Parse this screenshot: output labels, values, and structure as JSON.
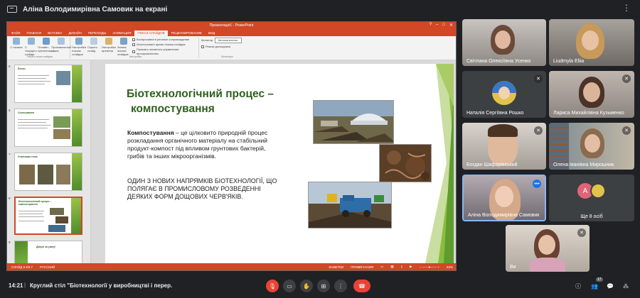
{
  "meet": {
    "presenting_label": "Аліна Володимирівна Самовик на екрані",
    "time": "14:21",
    "separator": "|",
    "meeting_title": "Круглий стіл \"Біотехнології у виробництві і перер...",
    "people_count": "17",
    "participants": [
      {
        "name": "Світлана Олексіївна Усенко"
      },
      {
        "name": "Liudmyla Eliia"
      },
      {
        "name": "Наталія Сергіївна Рошко"
      },
      {
        "name": "Лариса Михайлівна Кузьменко"
      },
      {
        "name": "Богдан Шафарівський"
      },
      {
        "name": "Олена Іванівна Мирошник"
      },
      {
        "name": "Аліна Володимирівна Самовик"
      },
      {
        "name": "Ще 8 осіб",
        "initial": "A"
      },
      {
        "name": "Ви"
      }
    ],
    "colors": {
      "bg": "#202124",
      "tile": "#3c4043",
      "red": "#ea4335",
      "accent": "#8ab4f8"
    }
  },
  "ppt": {
    "window_title": "Презентація1 - PowerPoint",
    "tabs": [
      "ФАЙЛ",
      "ГЛАВНАЯ",
      "ВСТАВКА",
      "ДИЗАЙН",
      "ПЕРЕХОДЫ",
      "АНИМАЦИЯ",
      "ПОКАЗ СЛАЙДОВ",
      "РЕЦЕНЗИРОВАНИЕ",
      "ВИД"
    ],
    "active_tab": "ПОКАЗ СЛАЙДОВ",
    "ribbon_buttons": [
      "С начала",
      "С текущего слайда",
      "Онлайн-презентация",
      "Произвольный показ",
      "Настройка показа слайдов",
      "Скрыть слайд",
      "Настройка времени",
      "Запись показа слайдов"
    ],
    "ribbon_checks": [
      "Воспроизвести речевое сопровождение",
      "Использовать время показа слайдов",
      "Показать элементы управления проигрывателем"
    ],
    "monitor_label": "Монитор:",
    "monitor_value": "Автоматически",
    "presenter_view": "Режим докладчика",
    "group_labels": [
      "Начать показ слайдов",
      "Настройка",
      "Мониторы"
    ],
    "status_left": "СЛАЙД 6 ИЗ 7",
    "status_lang": "РУССКИЙ",
    "status_notes": "ЗАМЕТКИ",
    "status_comments": "ПРИМЕЧАНИЯ",
    "zoom": "53%",
    "thumbnails": [
      {
        "num": "5",
        "title": "Біогаз"
      },
      {
        "num": "6",
        "title": "Силосування"
      },
      {
        "num": "7",
        "title": "Утилізація гною"
      },
      {
        "num": "8",
        "title": "Біотехнологічний процес – компостування"
      },
      {
        "num": "9",
        "title": "Дякую за увагу!"
      }
    ]
  },
  "slide": {
    "title_line1": "Біотехнологічний процес –",
    "title_line2": "компостування",
    "term": "Компостування",
    "definition": " – це цілковито природній процес розкладання органічного матеріалу на стабільний продукт-компост під впливом грунтових бактерій, грибів та інших мікроорганізмів.",
    "paragraph2": "ОДИН З НОВИХ НАПРЯМКІВ БІОТЕХНОЛОГІЇ, ЩО ПОЛЯГАЄ В ПРОМИСЛОВОМУ РОЗВЕДЕННІ ДЕЯКИХ ФОРМ ДОЩОВИХ ЧЕРВ'ЯКІВ.",
    "green_accent": "#5e9c2f"
  }
}
